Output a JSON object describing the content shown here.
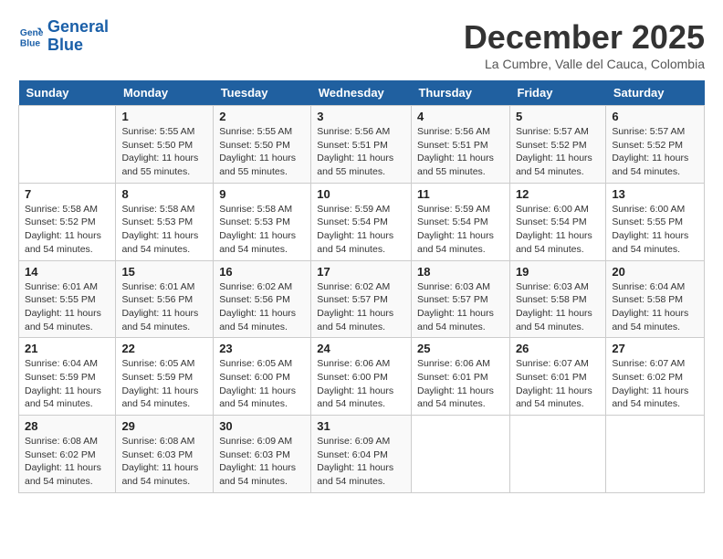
{
  "header": {
    "logo_line1": "General",
    "logo_line2": "Blue",
    "month_title": "December 2025",
    "subtitle": "La Cumbre, Valle del Cauca, Colombia"
  },
  "days_of_week": [
    "Sunday",
    "Monday",
    "Tuesday",
    "Wednesday",
    "Thursday",
    "Friday",
    "Saturday"
  ],
  "weeks": [
    [
      {
        "day": "",
        "info": ""
      },
      {
        "day": "1",
        "info": "Sunrise: 5:55 AM\nSunset: 5:50 PM\nDaylight: 11 hours\nand 55 minutes."
      },
      {
        "day": "2",
        "info": "Sunrise: 5:55 AM\nSunset: 5:50 PM\nDaylight: 11 hours\nand 55 minutes."
      },
      {
        "day": "3",
        "info": "Sunrise: 5:56 AM\nSunset: 5:51 PM\nDaylight: 11 hours\nand 55 minutes."
      },
      {
        "day": "4",
        "info": "Sunrise: 5:56 AM\nSunset: 5:51 PM\nDaylight: 11 hours\nand 55 minutes."
      },
      {
        "day": "5",
        "info": "Sunrise: 5:57 AM\nSunset: 5:52 PM\nDaylight: 11 hours\nand 54 minutes."
      },
      {
        "day": "6",
        "info": "Sunrise: 5:57 AM\nSunset: 5:52 PM\nDaylight: 11 hours\nand 54 minutes."
      }
    ],
    [
      {
        "day": "7",
        "info": "Sunrise: 5:58 AM\nSunset: 5:52 PM\nDaylight: 11 hours\nand 54 minutes."
      },
      {
        "day": "8",
        "info": "Sunrise: 5:58 AM\nSunset: 5:53 PM\nDaylight: 11 hours\nand 54 minutes."
      },
      {
        "day": "9",
        "info": "Sunrise: 5:58 AM\nSunset: 5:53 PM\nDaylight: 11 hours\nand 54 minutes."
      },
      {
        "day": "10",
        "info": "Sunrise: 5:59 AM\nSunset: 5:54 PM\nDaylight: 11 hours\nand 54 minutes."
      },
      {
        "day": "11",
        "info": "Sunrise: 5:59 AM\nSunset: 5:54 PM\nDaylight: 11 hours\nand 54 minutes."
      },
      {
        "day": "12",
        "info": "Sunrise: 6:00 AM\nSunset: 5:54 PM\nDaylight: 11 hours\nand 54 minutes."
      },
      {
        "day": "13",
        "info": "Sunrise: 6:00 AM\nSunset: 5:55 PM\nDaylight: 11 hours\nand 54 minutes."
      }
    ],
    [
      {
        "day": "14",
        "info": "Sunrise: 6:01 AM\nSunset: 5:55 PM\nDaylight: 11 hours\nand 54 minutes."
      },
      {
        "day": "15",
        "info": "Sunrise: 6:01 AM\nSunset: 5:56 PM\nDaylight: 11 hours\nand 54 minutes."
      },
      {
        "day": "16",
        "info": "Sunrise: 6:02 AM\nSunset: 5:56 PM\nDaylight: 11 hours\nand 54 minutes."
      },
      {
        "day": "17",
        "info": "Sunrise: 6:02 AM\nSunset: 5:57 PM\nDaylight: 11 hours\nand 54 minutes."
      },
      {
        "day": "18",
        "info": "Sunrise: 6:03 AM\nSunset: 5:57 PM\nDaylight: 11 hours\nand 54 minutes."
      },
      {
        "day": "19",
        "info": "Sunrise: 6:03 AM\nSunset: 5:58 PM\nDaylight: 11 hours\nand 54 minutes."
      },
      {
        "day": "20",
        "info": "Sunrise: 6:04 AM\nSunset: 5:58 PM\nDaylight: 11 hours\nand 54 minutes."
      }
    ],
    [
      {
        "day": "21",
        "info": "Sunrise: 6:04 AM\nSunset: 5:59 PM\nDaylight: 11 hours\nand 54 minutes."
      },
      {
        "day": "22",
        "info": "Sunrise: 6:05 AM\nSunset: 5:59 PM\nDaylight: 11 hours\nand 54 minutes."
      },
      {
        "day": "23",
        "info": "Sunrise: 6:05 AM\nSunset: 6:00 PM\nDaylight: 11 hours\nand 54 minutes."
      },
      {
        "day": "24",
        "info": "Sunrise: 6:06 AM\nSunset: 6:00 PM\nDaylight: 11 hours\nand 54 minutes."
      },
      {
        "day": "25",
        "info": "Sunrise: 6:06 AM\nSunset: 6:01 PM\nDaylight: 11 hours\nand 54 minutes."
      },
      {
        "day": "26",
        "info": "Sunrise: 6:07 AM\nSunset: 6:01 PM\nDaylight: 11 hours\nand 54 minutes."
      },
      {
        "day": "27",
        "info": "Sunrise: 6:07 AM\nSunset: 6:02 PM\nDaylight: 11 hours\nand 54 minutes."
      }
    ],
    [
      {
        "day": "28",
        "info": "Sunrise: 6:08 AM\nSunset: 6:02 PM\nDaylight: 11 hours\nand 54 minutes."
      },
      {
        "day": "29",
        "info": "Sunrise: 6:08 AM\nSunset: 6:03 PM\nDaylight: 11 hours\nand 54 minutes."
      },
      {
        "day": "30",
        "info": "Sunrise: 6:09 AM\nSunset: 6:03 PM\nDaylight: 11 hours\nand 54 minutes."
      },
      {
        "day": "31",
        "info": "Sunrise: 6:09 AM\nSunset: 6:04 PM\nDaylight: 11 hours\nand 54 minutes."
      },
      {
        "day": "",
        "info": ""
      },
      {
        "day": "",
        "info": ""
      },
      {
        "day": "",
        "info": ""
      }
    ]
  ]
}
